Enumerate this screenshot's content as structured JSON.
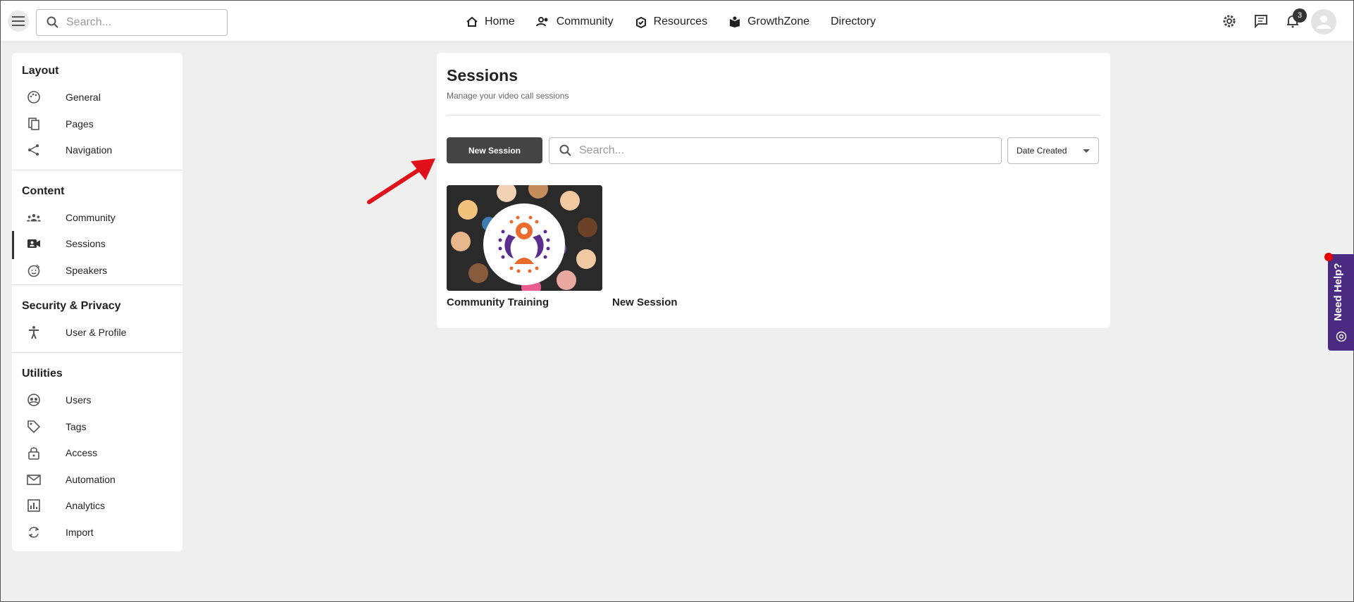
{
  "topbar": {
    "search_placeholder": "Search...",
    "nav": [
      {
        "label": "Home",
        "icon": "home-icon"
      },
      {
        "label": "Community",
        "icon": "people-icon"
      },
      {
        "label": "Resources",
        "icon": "resources-icon"
      },
      {
        "label": "GrowthZone",
        "icon": "book-icon"
      },
      {
        "label": "Directory",
        "icon": ""
      }
    ],
    "notification_count": "3"
  },
  "sidebar": {
    "sections": [
      {
        "title": "Layout",
        "items": [
          {
            "label": "General",
            "icon": "palette-icon"
          },
          {
            "label": "Pages",
            "icon": "pages-icon"
          },
          {
            "label": "Navigation",
            "icon": "share-icon"
          }
        ]
      },
      {
        "title": "Content",
        "items": [
          {
            "label": "Community",
            "icon": "groups-icon"
          },
          {
            "label": "Sessions",
            "icon": "video-call-icon"
          },
          {
            "label": "Speakers",
            "icon": "face-icon"
          }
        ]
      },
      {
        "title": "Security & Privacy",
        "items": [
          {
            "label": "User & Profile",
            "icon": "accessibility-icon"
          }
        ]
      },
      {
        "title": "Utilities",
        "items": [
          {
            "label": "Users",
            "icon": "users-icon"
          },
          {
            "label": "Tags",
            "icon": "tag-icon"
          },
          {
            "label": "Access",
            "icon": "lock-icon"
          },
          {
            "label": "Automation",
            "icon": "mail-icon"
          },
          {
            "label": "Analytics",
            "icon": "analytics-icon"
          },
          {
            "label": "Import",
            "icon": "sync-icon"
          }
        ]
      }
    ]
  },
  "main": {
    "title": "Sessions",
    "subtitle": "Manage your video call sessions",
    "new_button": "New Session",
    "search_placeholder": "Search...",
    "sort_label": "Date Created",
    "cards": [
      {
        "title": "Community Training"
      },
      {
        "title": "New Session"
      }
    ]
  },
  "help": {
    "label": "Need Help?"
  },
  "colors": {
    "help_bg": "#4b2a82",
    "arrow": "#e0111b",
    "button": "#444444"
  }
}
